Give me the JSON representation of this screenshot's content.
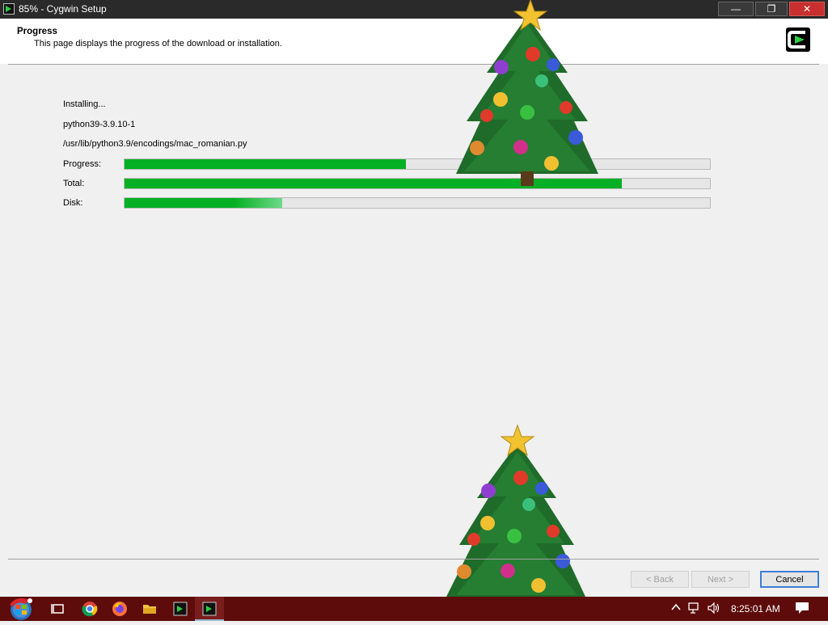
{
  "window": {
    "title": "85% - Cygwin Setup",
    "buttons": {
      "minimize": "—",
      "maximize": "❐",
      "close": "✕"
    }
  },
  "header": {
    "title": "Progress",
    "description": "This page displays the progress of the download or installation."
  },
  "main": {
    "status": "Installing...",
    "package": "python39-3.9.10-1",
    "file": "/usr/lib/python3.9/encodings/mac_romanian.py",
    "progress": {
      "label": "Progress:",
      "fraction": 0.48
    },
    "total": {
      "label": "Total:",
      "fraction": 0.85
    },
    "disk": {
      "label": "Disk:",
      "fraction": 0.27
    }
  },
  "footer": {
    "back_label": "< Back",
    "next_label": "Next >",
    "cancel_label": "Cancel"
  },
  "taskbar": {
    "clock": "8:25:01 AM",
    "icons": [
      "start-orb-icon",
      "task-view-icon",
      "chrome-icon",
      "firefox-icon",
      "file-explorer-icon",
      "cygwin-terminal-icon",
      "cygwin-setup-icon"
    ],
    "tray": [
      "show-hidden-icons-chevron",
      "network-icon",
      "volume-icon",
      "notifications-icon"
    ]
  },
  "colors": {
    "progress_fill": "#06b025",
    "titlebar": "#2a2a2a",
    "close_button": "#c7302e",
    "taskbar": "#5e0b0b",
    "cancel_focus_border": "#3c7fd6"
  }
}
